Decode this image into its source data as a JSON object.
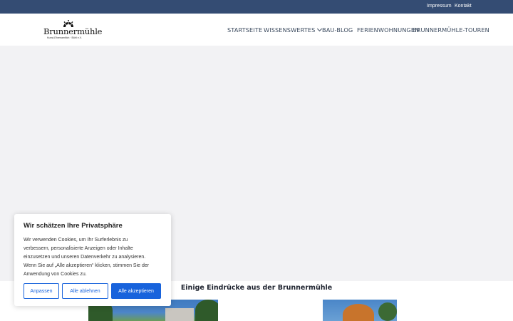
{
  "topbar": {
    "links": [
      "Impressum",
      "Kontakt"
    ],
    "bg_color": "#344c73"
  },
  "logo": {
    "brand": "Brunnermühle",
    "tagline": "Kunst-Ehrenamtlich · Bühl e.V."
  },
  "nav": {
    "items": [
      {
        "label": "STARTSEITE"
      },
      {
        "label": "WISSENSWERTES",
        "has_dropdown": true
      },
      {
        "label": "BAU-BLOG"
      },
      {
        "label": "FERIENWOHNUNGEN"
      },
      {
        "label": "BRUNNERMÜHLE-TOUREN"
      }
    ]
  },
  "section": {
    "title": "Einige Eindrücke aus der Brunnermühle"
  },
  "cookie": {
    "title": "Wir schätzen Ihre Privatsphäre",
    "lines": [
      "Wir verwenden Cookies, um Ihr Surferlebnis zu",
      "verbessern, personalisierte Anzeigen oder Inhalte",
      "einzusetzen und unseren Datenverkehr zu analysieren.",
      "Wenn Sie auf „Alle akzeptieren“ klicken, stimmen Sie der",
      "Anwendung von Cookies zu."
    ],
    "buttons": {
      "customize": "Anpassen",
      "reject": "Alle ablehnen",
      "accept": "Alle akzeptieren"
    },
    "accent_color": "#1863dc"
  }
}
